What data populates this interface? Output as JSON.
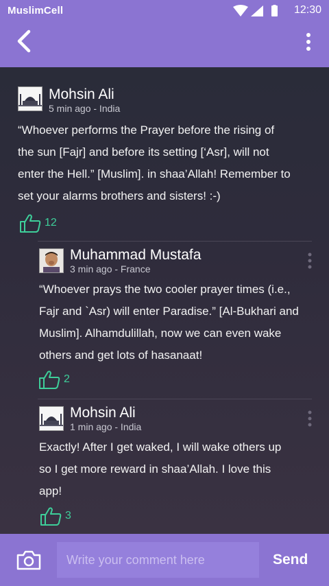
{
  "status_bar": {
    "app_name": "MuslimCell",
    "time": "12:30",
    "icons": [
      "wifi-icon",
      "cellular-signal-icon",
      "battery-icon"
    ]
  },
  "app_bar": {
    "back_icon": "chevron-left-icon",
    "menu_icon": "more-vertical-icon"
  },
  "colors": {
    "primary": "#8b74d2",
    "background": "#2a2a37",
    "like_accent": "#3ecf9a",
    "input_background": "#9580dc"
  },
  "posts": [
    {
      "author": "Mohsin Ali",
      "meta": "5 min ago - India",
      "avatar": "mosque-avatar",
      "text": "“Whoever performs the Prayer before the rising of the sun [Fajr] and before its setting [‘Asr], will not enter the Hell.” [Muslim]. in shaa’Allah! Remember to set your alarms brothers and sisters! :-)",
      "lines": [
        "“Whoever performs the Prayer before the rising of",
        "the sun [Fajr] and before its setting [‘Asr], will not",
        "enter the Hell.” [Muslim]. in shaa’Allah! Remember to",
        "set your alarms brothers and sisters! :-)"
      ],
      "likes": "12"
    }
  ],
  "replies": [
    {
      "author": "Muhammad Mustafa",
      "meta": "3 min ago - France",
      "avatar": "person-photo-avatar",
      "lines": [
        "“Whoever prays the two cooler prayer times (i.e.,",
        "Fajr and `Asr) will enter Paradise.” [Al-Bukhari and",
        "Muslim]. Alhamdulillah, now we can even wake",
        "others and get lots of hasanaat!"
      ],
      "likes": "2"
    },
    {
      "author": "Mohsin Ali",
      "meta": "1 min ago - India",
      "avatar": "mosque-avatar",
      "lines": [
        "Exactly! After I get waked, I will wake others up",
        "so I get more reward in shaa’Allah. I love this",
        "app!"
      ],
      "likes": "3"
    }
  ],
  "composer": {
    "camera_icon": "camera-icon",
    "placeholder": "Write your comment here",
    "send_label": "Send"
  }
}
